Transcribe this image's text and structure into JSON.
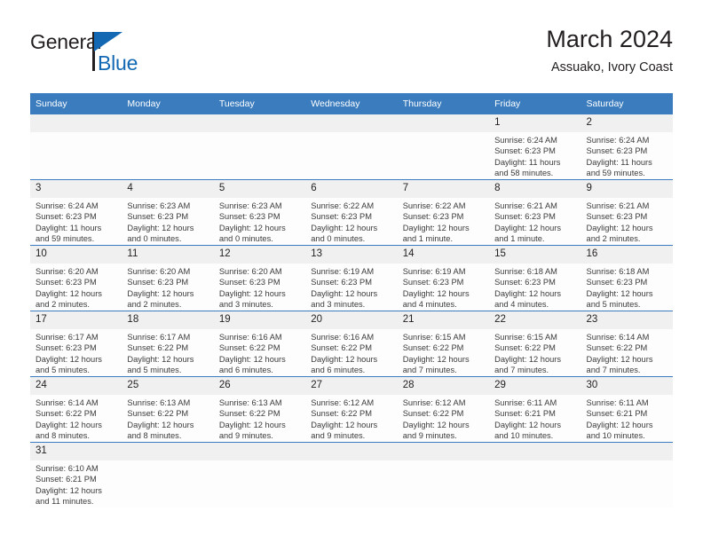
{
  "brand": {
    "name_part1": "General",
    "name_part2": "Blue",
    "flag_color": "#1268b3"
  },
  "header": {
    "title": "March 2024",
    "subtitle": "Assuako, Ivory Coast",
    "accent_color": "#3a7cbe",
    "daynum_band_color": "#f0f0f0"
  },
  "weekday_headers": [
    "Sunday",
    "Monday",
    "Tuesday",
    "Wednesday",
    "Thursday",
    "Friday",
    "Saturday"
  ],
  "labels": {
    "sunrise_prefix": "Sunrise:",
    "sunset_prefix": "Sunset:",
    "daylight_prefix": "Daylight:"
  },
  "weeks": [
    [
      {
        "day": "",
        "lines": []
      },
      {
        "day": "",
        "lines": []
      },
      {
        "day": "",
        "lines": []
      },
      {
        "day": "",
        "lines": []
      },
      {
        "day": "",
        "lines": []
      },
      {
        "day": "1",
        "lines": [
          "Sunrise: 6:24 AM",
          "Sunset: 6:23 PM",
          "Daylight: 11 hours",
          "and 58 minutes."
        ]
      },
      {
        "day": "2",
        "lines": [
          "Sunrise: 6:24 AM",
          "Sunset: 6:23 PM",
          "Daylight: 11 hours",
          "and 59 minutes."
        ]
      }
    ],
    [
      {
        "day": "3",
        "lines": [
          "Sunrise: 6:24 AM",
          "Sunset: 6:23 PM",
          "Daylight: 11 hours",
          "and 59 minutes."
        ]
      },
      {
        "day": "4",
        "lines": [
          "Sunrise: 6:23 AM",
          "Sunset: 6:23 PM",
          "Daylight: 12 hours",
          "and 0 minutes."
        ]
      },
      {
        "day": "5",
        "lines": [
          "Sunrise: 6:23 AM",
          "Sunset: 6:23 PM",
          "Daylight: 12 hours",
          "and 0 minutes."
        ]
      },
      {
        "day": "6",
        "lines": [
          "Sunrise: 6:22 AM",
          "Sunset: 6:23 PM",
          "Daylight: 12 hours",
          "and 0 minutes."
        ]
      },
      {
        "day": "7",
        "lines": [
          "Sunrise: 6:22 AM",
          "Sunset: 6:23 PM",
          "Daylight: 12 hours",
          "and 1 minute."
        ]
      },
      {
        "day": "8",
        "lines": [
          "Sunrise: 6:21 AM",
          "Sunset: 6:23 PM",
          "Daylight: 12 hours",
          "and 1 minute."
        ]
      },
      {
        "day": "9",
        "lines": [
          "Sunrise: 6:21 AM",
          "Sunset: 6:23 PM",
          "Daylight: 12 hours",
          "and 2 minutes."
        ]
      }
    ],
    [
      {
        "day": "10",
        "lines": [
          "Sunrise: 6:20 AM",
          "Sunset: 6:23 PM",
          "Daylight: 12 hours",
          "and 2 minutes."
        ]
      },
      {
        "day": "11",
        "lines": [
          "Sunrise: 6:20 AM",
          "Sunset: 6:23 PM",
          "Daylight: 12 hours",
          "and 2 minutes."
        ]
      },
      {
        "day": "12",
        "lines": [
          "Sunrise: 6:20 AM",
          "Sunset: 6:23 PM",
          "Daylight: 12 hours",
          "and 3 minutes."
        ]
      },
      {
        "day": "13",
        "lines": [
          "Sunrise: 6:19 AM",
          "Sunset: 6:23 PM",
          "Daylight: 12 hours",
          "and 3 minutes."
        ]
      },
      {
        "day": "14",
        "lines": [
          "Sunrise: 6:19 AM",
          "Sunset: 6:23 PM",
          "Daylight: 12 hours",
          "and 4 minutes."
        ]
      },
      {
        "day": "15",
        "lines": [
          "Sunrise: 6:18 AM",
          "Sunset: 6:23 PM",
          "Daylight: 12 hours",
          "and 4 minutes."
        ]
      },
      {
        "day": "16",
        "lines": [
          "Sunrise: 6:18 AM",
          "Sunset: 6:23 PM",
          "Daylight: 12 hours",
          "and 5 minutes."
        ]
      }
    ],
    [
      {
        "day": "17",
        "lines": [
          "Sunrise: 6:17 AM",
          "Sunset: 6:23 PM",
          "Daylight: 12 hours",
          "and 5 minutes."
        ]
      },
      {
        "day": "18",
        "lines": [
          "Sunrise: 6:17 AM",
          "Sunset: 6:22 PM",
          "Daylight: 12 hours",
          "and 5 minutes."
        ]
      },
      {
        "day": "19",
        "lines": [
          "Sunrise: 6:16 AM",
          "Sunset: 6:22 PM",
          "Daylight: 12 hours",
          "and 6 minutes."
        ]
      },
      {
        "day": "20",
        "lines": [
          "Sunrise: 6:16 AM",
          "Sunset: 6:22 PM",
          "Daylight: 12 hours",
          "and 6 minutes."
        ]
      },
      {
        "day": "21",
        "lines": [
          "Sunrise: 6:15 AM",
          "Sunset: 6:22 PM",
          "Daylight: 12 hours",
          "and 7 minutes."
        ]
      },
      {
        "day": "22",
        "lines": [
          "Sunrise: 6:15 AM",
          "Sunset: 6:22 PM",
          "Daylight: 12 hours",
          "and 7 minutes."
        ]
      },
      {
        "day": "23",
        "lines": [
          "Sunrise: 6:14 AM",
          "Sunset: 6:22 PM",
          "Daylight: 12 hours",
          "and 7 minutes."
        ]
      }
    ],
    [
      {
        "day": "24",
        "lines": [
          "Sunrise: 6:14 AM",
          "Sunset: 6:22 PM",
          "Daylight: 12 hours",
          "and 8 minutes."
        ]
      },
      {
        "day": "25",
        "lines": [
          "Sunrise: 6:13 AM",
          "Sunset: 6:22 PM",
          "Daylight: 12 hours",
          "and 8 minutes."
        ]
      },
      {
        "day": "26",
        "lines": [
          "Sunrise: 6:13 AM",
          "Sunset: 6:22 PM",
          "Daylight: 12 hours",
          "and 9 minutes."
        ]
      },
      {
        "day": "27",
        "lines": [
          "Sunrise: 6:12 AM",
          "Sunset: 6:22 PM",
          "Daylight: 12 hours",
          "and 9 minutes."
        ]
      },
      {
        "day": "28",
        "lines": [
          "Sunrise: 6:12 AM",
          "Sunset: 6:22 PM",
          "Daylight: 12 hours",
          "and 9 minutes."
        ]
      },
      {
        "day": "29",
        "lines": [
          "Sunrise: 6:11 AM",
          "Sunset: 6:21 PM",
          "Daylight: 12 hours",
          "and 10 minutes."
        ]
      },
      {
        "day": "30",
        "lines": [
          "Sunrise: 6:11 AM",
          "Sunset: 6:21 PM",
          "Daylight: 12 hours",
          "and 10 minutes."
        ]
      }
    ],
    [
      {
        "day": "31",
        "lines": [
          "Sunrise: 6:10 AM",
          "Sunset: 6:21 PM",
          "Daylight: 12 hours",
          "and 11 minutes."
        ]
      },
      {
        "day": "",
        "lines": []
      },
      {
        "day": "",
        "lines": []
      },
      {
        "day": "",
        "lines": []
      },
      {
        "day": "",
        "lines": []
      },
      {
        "day": "",
        "lines": []
      },
      {
        "day": "",
        "lines": []
      }
    ]
  ]
}
